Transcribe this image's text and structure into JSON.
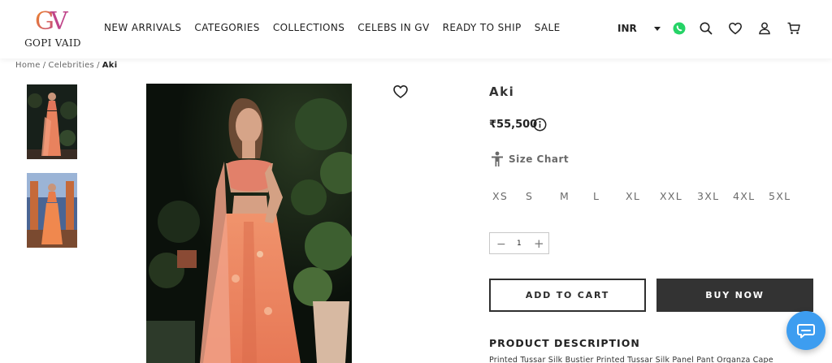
{
  "brand": {
    "logo_mark": "GV",
    "name": "GOPI VAID"
  },
  "nav": {
    "items": [
      {
        "label": "NEW ARRIVALS"
      },
      {
        "label": "CATEGORIES"
      },
      {
        "label": "COLLECTIONS"
      },
      {
        "label": "CELEBS IN GV"
      },
      {
        "label": "READY TO SHIP"
      },
      {
        "label": "SALE"
      }
    ]
  },
  "header": {
    "currency": "INR",
    "icons": [
      "whatsapp-icon",
      "search-icon",
      "heart-icon",
      "user-icon",
      "cart-icon"
    ]
  },
  "breadcrumb": {
    "items": [
      "Home",
      "Celebrities",
      "Aki"
    ],
    "separator": "/"
  },
  "product": {
    "title": "Aki",
    "price": "₹55,500",
    "size_chart_label": "Size Chart",
    "sizes": [
      "XS",
      "S",
      "M",
      "L",
      "XL",
      "XXL",
      "3XL",
      "4XL",
      "5XL"
    ],
    "quantity": "1",
    "add_to_cart_label": "ADD TO CART",
    "buy_now_label": "BUY NOW",
    "description_heading": "PRODUCT DESCRIPTION",
    "description_text": "Printed Tussar Silk Bustier Printed Tussar Silk Panel Pant Organza Cape"
  },
  "colors": {
    "brand_orange": "#e8782a",
    "brand_pink": "#c0458a",
    "whatsapp_green": "#25d366",
    "buy_button": "#333333",
    "chat_button": "#3d9df0"
  }
}
